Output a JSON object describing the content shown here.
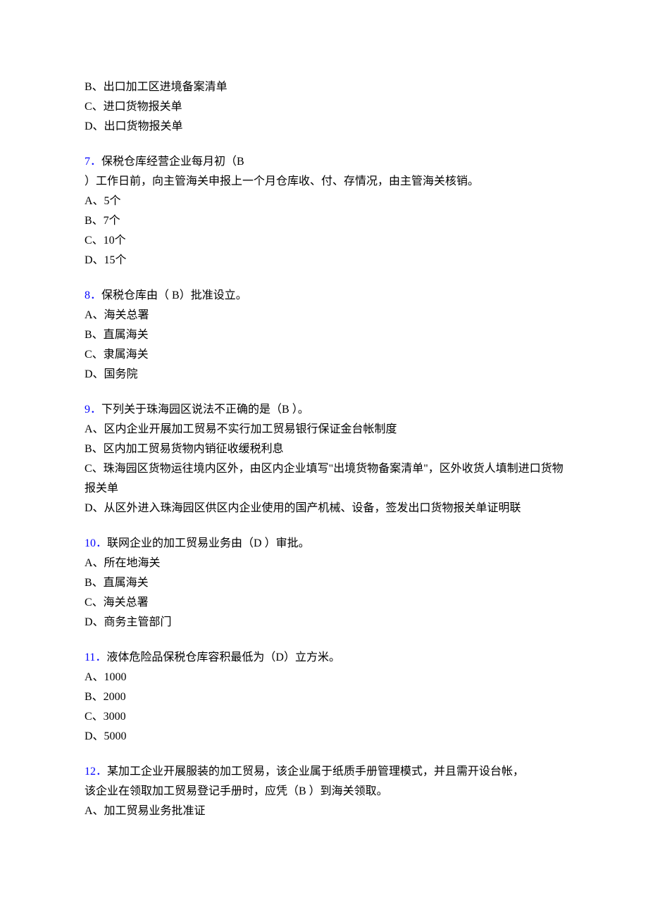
{
  "q6_tail": {
    "opts": [
      "B、出口加工区进境备案清单",
      "C、进口货物报关单",
      "D、出口货物报关单"
    ]
  },
  "q7": {
    "num": "7．",
    "line1": "保税仓库经营企业每月初（B",
    "line2": "）工作日前，向主管海关申报上一个月仓库收、付、存情况，由主管海关核销。",
    "opts": [
      "A、5个",
      "B、7个",
      "C、10个",
      "D、15个"
    ]
  },
  "q8": {
    "num": "8．",
    "text": "保税仓库由（ B）批准设立。",
    "opts": [
      "A、海关总署",
      "B、直属海关",
      "C、隶属海关",
      "D、国务院"
    ]
  },
  "q9": {
    "num": "9．",
    "text": "下列关于珠海园区说法不正确的是（B ）。",
    "opts": [
      "A、区内企业开展加工贸易不实行加工贸易银行保证金台帐制度",
      "B、区内加工贸易货物内销征收缓税利息",
      "C、珠海园区货物运往境内区外，由区内企业填写\"出境货物备案清单\"，区外收货人填制进口货物报关单",
      "D、从区外进入珠海园区供区内企业使用的国产机械、设备，签发出口货物报关单证明联"
    ]
  },
  "q10": {
    "num": "10．",
    "text": "联网企业的加工贸易业务由（D ）审批。",
    "opts": [
      "A、所在地海关",
      "B、直属海关",
      "C、海关总署",
      "D、商务主管部门"
    ]
  },
  "q11": {
    "num": "11．",
    "text": "液体危险品保税仓库容积最低为（D）立方米。",
    "opts": [
      "A、1000",
      "B、2000",
      "C、3000",
      "D、5000"
    ]
  },
  "q12": {
    "num": "12．",
    "line1": "某加工企业开展服装的加工贸易，该企业属于纸质手册管理模式，并且需开设台帐，",
    "line2": "该企业在领取加工贸易登记手册时，应凭（B ）到海关领取。",
    "opts": [
      "A、加工贸易业务批准证"
    ]
  }
}
